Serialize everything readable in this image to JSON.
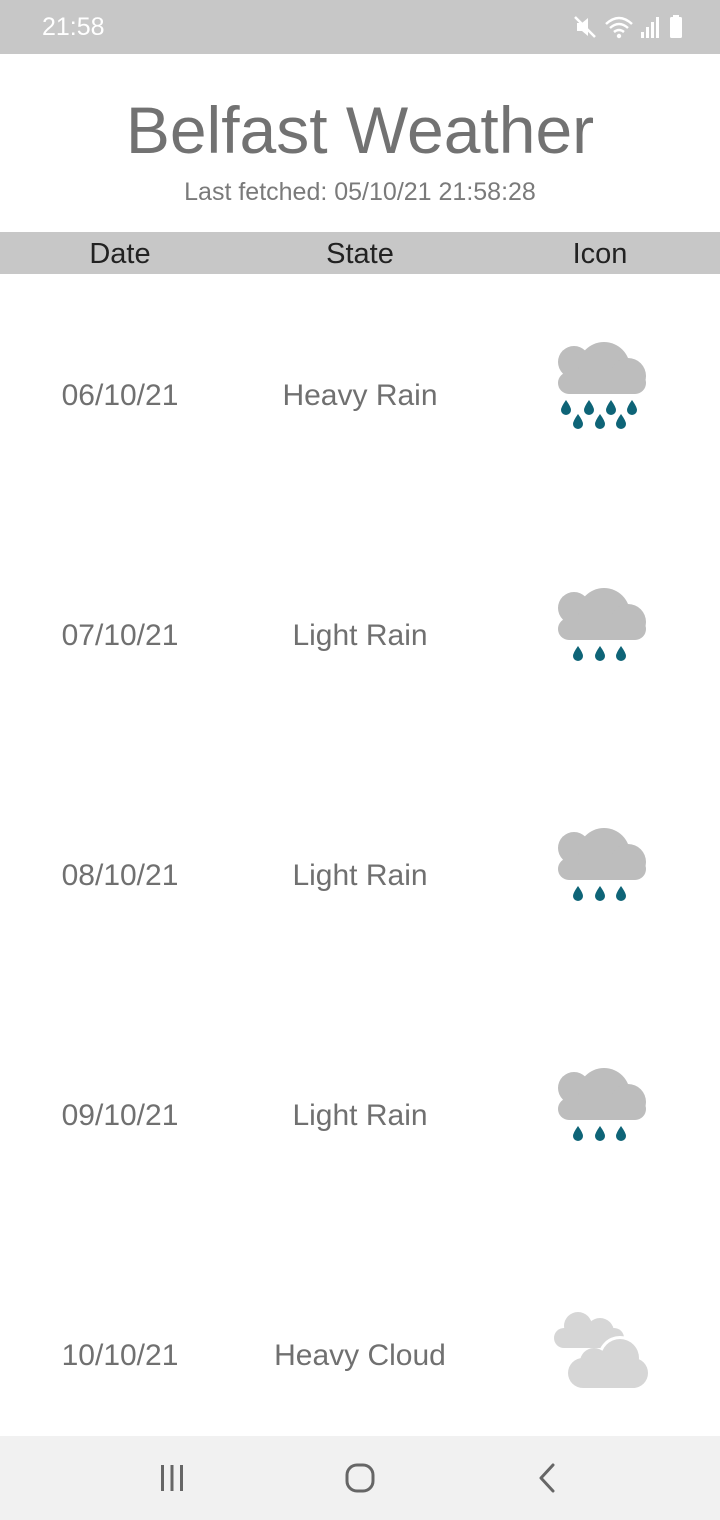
{
  "status_bar": {
    "time": "21:58",
    "icons": [
      "mute-icon",
      "wifi-icon",
      "signal-icon",
      "battery-icon"
    ]
  },
  "header": {
    "title": "Belfast Weather",
    "subtitle": "Last fetched: 05/10/21 21:58:28"
  },
  "columns": {
    "date": "Date",
    "state": "State",
    "icon": "Icon"
  },
  "forecast": [
    {
      "date": "06/10/21",
      "state": "Heavy Rain",
      "icon": "heavy-rain-icon"
    },
    {
      "date": "07/10/21",
      "state": "Light Rain",
      "icon": "light-rain-icon"
    },
    {
      "date": "08/10/21",
      "state": "Light Rain",
      "icon": "light-rain-icon"
    },
    {
      "date": "09/10/21",
      "state": "Light Rain",
      "icon": "light-rain-icon"
    },
    {
      "date": "10/10/21",
      "state": "Heavy Cloud",
      "icon": "heavy-cloud-icon"
    }
  ],
  "nav_bar": {
    "buttons": [
      "recents-icon",
      "home-icon",
      "back-icon"
    ]
  },
  "colors": {
    "status_bar_bg": "#c7c7c7",
    "header_bar_bg": "#c7c7c7",
    "cloud": "#bdbdbd",
    "light_cloud": "#d6d6d6",
    "rain_drop": "#0e6477",
    "text_gray": "#707070"
  }
}
